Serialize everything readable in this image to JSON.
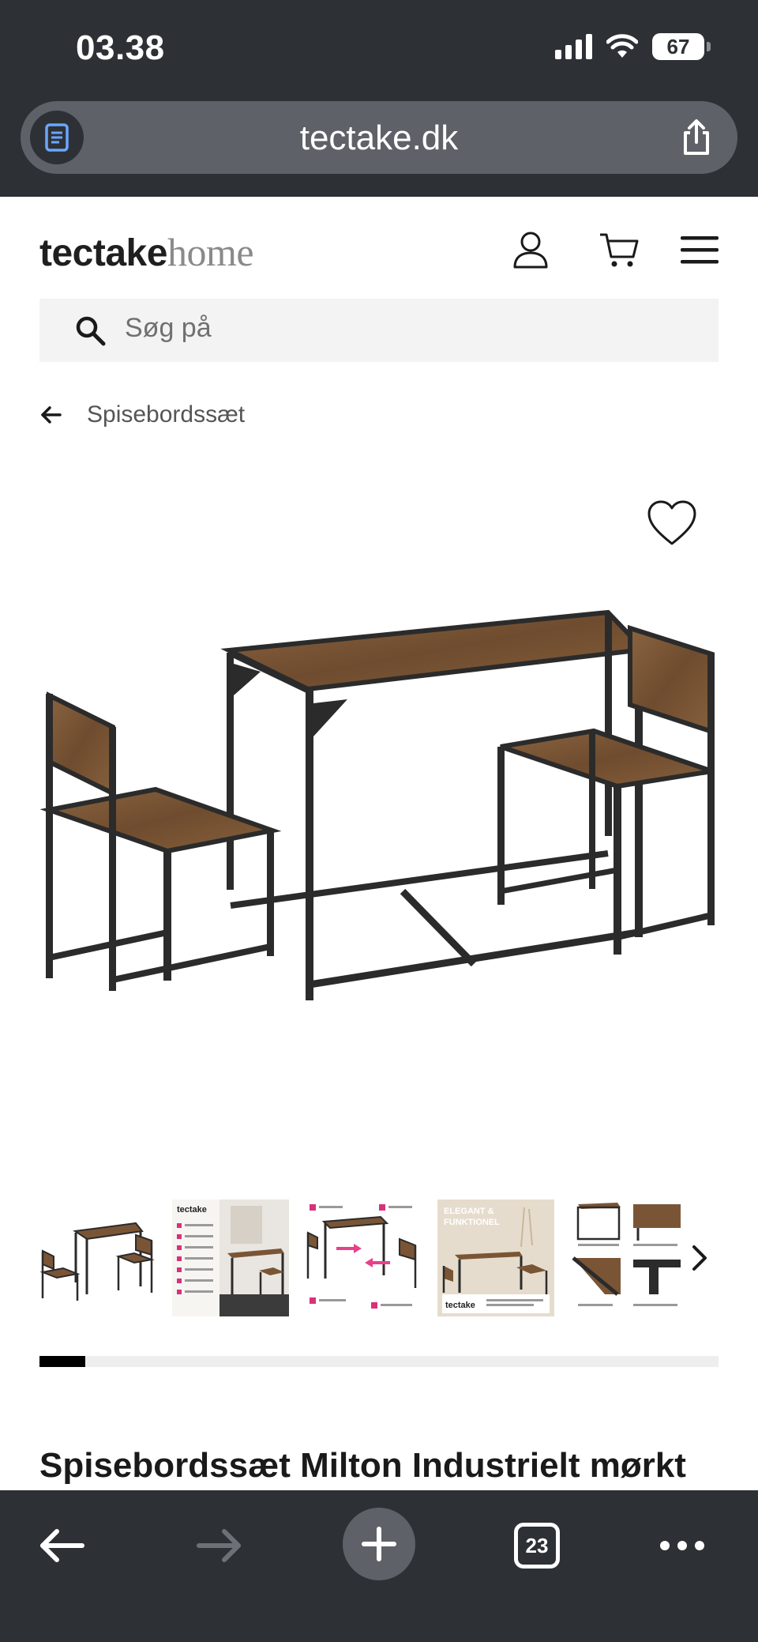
{
  "status_bar": {
    "time": "03.38",
    "battery": "67",
    "icons": [
      "signal-icon",
      "wifi-icon",
      "battery-icon"
    ]
  },
  "browser": {
    "url": "tectake.dk",
    "reader_icon": "reader-icon",
    "share_icon": "share-icon"
  },
  "header": {
    "logo_bold": "tectake",
    "logo_light": "home",
    "icons": [
      "user-icon",
      "cart-icon",
      "menu-icon"
    ]
  },
  "search": {
    "placeholder": "Søg på"
  },
  "breadcrumb": {
    "label": "Spisebordssæt"
  },
  "product": {
    "title": "Spisebordssæt Milton Industrielt mørkt",
    "thumb_texts": {
      "brand": "tectake",
      "elegant": "ELEGANT &",
      "funktionel": "FUNKTIONEL"
    },
    "gallery_progress": 0.068
  },
  "bottom_bar": {
    "tab_count": "23"
  },
  "colors": {
    "chrome": "#2d3035",
    "url_bar": "#5e6268",
    "wood": "#7a5535",
    "metal": "#2b2b2b",
    "search_bg": "#f3f3f3"
  }
}
